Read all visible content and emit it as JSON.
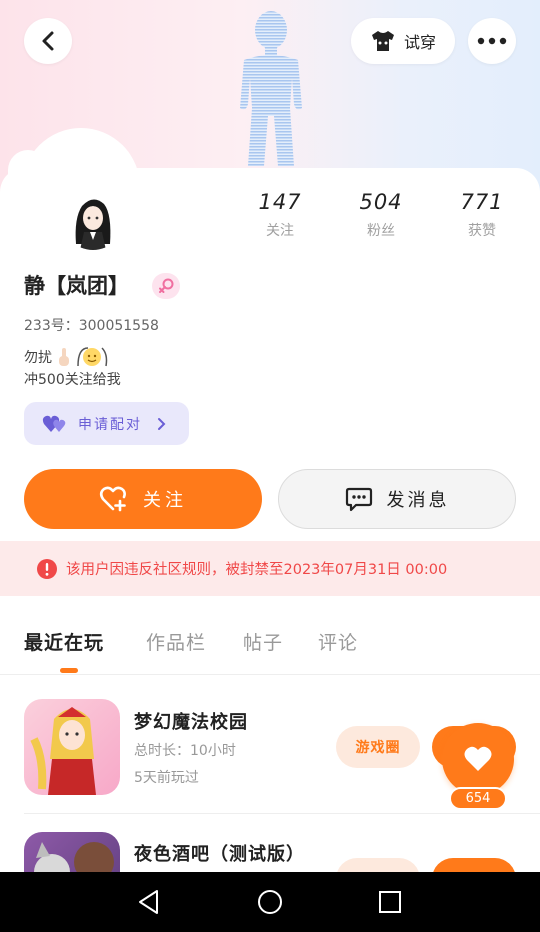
{
  "header": {
    "tryon_label": "试穿"
  },
  "profile": {
    "name": "静【岚团】",
    "uid_text": "233号：300051558",
    "bio_line1": "勿扰",
    "bio_line2": "冲500关注给我",
    "pair_label": "申请配对",
    "stats": [
      {
        "value": "147",
        "label": "关注"
      },
      {
        "value": "504",
        "label": "粉丝"
      },
      {
        "value": "771",
        "label": "获赞"
      }
    ]
  },
  "actions": {
    "follow_label": "关注",
    "message_label": "发消息"
  },
  "ban_notice": "该用户因违反社区规则，被封禁至2023年07月31日 00:00",
  "tabs": [
    {
      "label": "最近在玩",
      "active": true
    },
    {
      "label": "作品栏",
      "active": false
    },
    {
      "label": "帖子",
      "active": false
    },
    {
      "label": "评论",
      "active": false
    }
  ],
  "games": [
    {
      "title": "梦幻魔法校园",
      "playtime": "总时长：10小时",
      "last_played": "5天前玩过",
      "circle_label": "游戏圈"
    },
    {
      "title": "夜色酒吧（测试版）"
    }
  ],
  "like_count": "654",
  "colors": {
    "accent": "#ff7a1a",
    "pair_purple": "#6a5ed6",
    "ban_red": "#f04848"
  }
}
